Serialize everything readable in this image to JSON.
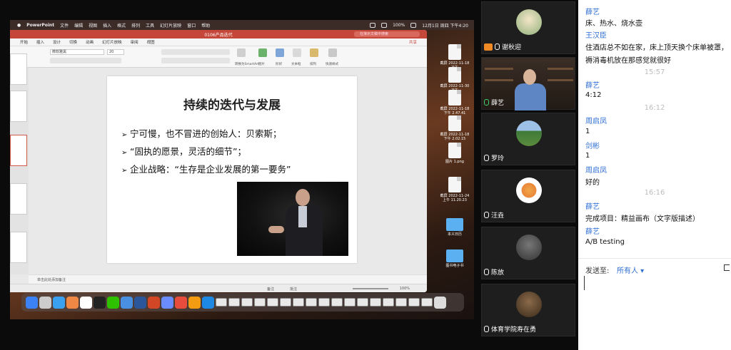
{
  "mac_menubar": {
    "app": "PowerPoint",
    "items": [
      "文件",
      "编辑",
      "视图",
      "插入",
      "格式",
      "排列",
      "工具",
      "幻灯片放映",
      "窗口",
      "帮助"
    ],
    "battery": "100%",
    "clock": "12月1日 周四 下午4:20"
  },
  "ppt": {
    "filename": "0106产品迭代",
    "search_placeholder": "在演示文稿中搜索",
    "tabs": [
      "开始",
      "插入",
      "设计",
      "切换",
      "动画",
      "幻灯片放映",
      "审阅",
      "视图"
    ],
    "share": "共享",
    "font_name": "微软雅黑",
    "font_size": "20",
    "ribbon_labels": [
      "图片",
      "形状",
      "文本框",
      "排列",
      "快速样式",
      "转换为SmartArt"
    ],
    "notes_placeholder": "单击此处添加备注",
    "status_notes": "备注",
    "status_comments": "批注",
    "zoom": "100%"
  },
  "slide": {
    "title": "持续的迭代与发展",
    "bullets": [
      "宁可慢，也不冒进的创始人：贝索斯；",
      "“固执的愿景，灵活的细节”；",
      "企业战略：“生存是企业发展的第一要务”"
    ],
    "bullet_marker": "➢"
  },
  "desktop_icons": [
    {
      "label": "截屏 2022-11-18 下午"
    },
    {
      "label": "截屏 2022-11-30 下午"
    },
    {
      "label": "截屏 2022-11-18 下午 2.47.41"
    },
    {
      "label": "截屏 2022-11-18 下午 2.02.15"
    },
    {
      "label": "图片 1.png"
    },
    {
      "label": "截屏 2022-11-24 上午 11.20.23"
    },
    {
      "label": "本义日历"
    },
    {
      "label": "图书电子书"
    }
  ],
  "participants": [
    {
      "name": "谢秋迎",
      "state": "camera-off"
    },
    {
      "name": "薛艺",
      "state": "live"
    },
    {
      "name": "罗玲",
      "state": "avatar"
    },
    {
      "name": "汪垚",
      "state": "avatar"
    },
    {
      "name": "陈放",
      "state": "avatar"
    },
    {
      "name": "体育学院寿在勇",
      "state": "avatar"
    }
  ],
  "chat": {
    "messages": [
      {
        "type": "sender",
        "text": "薛艺"
      },
      {
        "type": "text",
        "text": "床、热水、烧水壶"
      },
      {
        "type": "sender",
        "text": "王汉臣"
      },
      {
        "type": "text",
        "text": "住酒店总不如在家，床上顶天换个床单被罩，"
      },
      {
        "type": "text",
        "text": "褥消毒机放在那感觉就很好"
      },
      {
        "type": "time",
        "text": "15:57"
      },
      {
        "type": "sender",
        "text": "薛艺"
      },
      {
        "type": "text",
        "text": "4:12"
      },
      {
        "type": "time",
        "text": "16:12"
      },
      {
        "type": "sender",
        "text": "周启凤"
      },
      {
        "type": "text",
        "text": "1"
      },
      {
        "type": "sender",
        "text": "剑彬"
      },
      {
        "type": "text",
        "text": "1"
      },
      {
        "type": "sender",
        "text": "周启凤"
      },
      {
        "type": "text",
        "text": "好的"
      },
      {
        "type": "time",
        "text": "16:16"
      },
      {
        "type": "sender",
        "text": "薛艺"
      },
      {
        "type": "text",
        "text": "完成项目：精益画布（文字版描述）"
      },
      {
        "type": "sender",
        "text": "薛艺"
      },
      {
        "type": "text",
        "text": "A/B testing"
      }
    ],
    "send_to_label": "发送至:",
    "send_to_value": "所有人 ▾",
    "input_value": ""
  }
}
